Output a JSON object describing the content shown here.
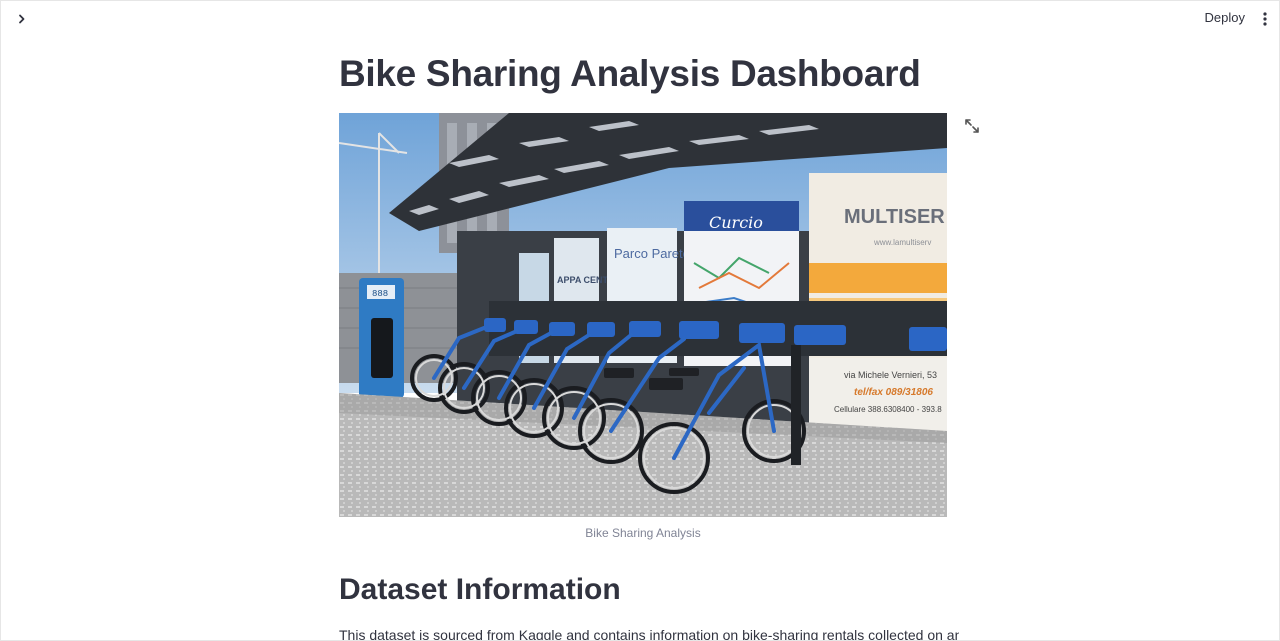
{
  "header": {
    "deploy_label": "Deploy",
    "sidebar_toggle_icon": "chevron-right-icon",
    "menu_icon": "more-vertical-icon"
  },
  "main": {
    "title": "Bike Sharing Analysis Dashboard",
    "image": {
      "caption": "Bike Sharing Analysis",
      "expand_icon": "fullscreen-icon",
      "signage": {
        "panel_1": "APPA CENTO",
        "panel_2": "Parco Pareto",
        "panel_3": "Curcio",
        "panel_4": "MULTISER",
        "panel_4_small": "www.lamultiserv",
        "panel_4_address": "via Michele Vernieri, 53",
        "panel_4_fax": "tel/fax 089/31806",
        "panel_4_cell": "Cellulare 388.6308400 - 393.8",
        "kiosk_screen": "888"
      }
    },
    "section_heading": "Dataset Information",
    "section_text": "This dataset is sourced from Kaggle and contains information on bike-sharing rentals collected on an"
  },
  "colors": {
    "text": "#31333f",
    "caption": "#808495"
  }
}
